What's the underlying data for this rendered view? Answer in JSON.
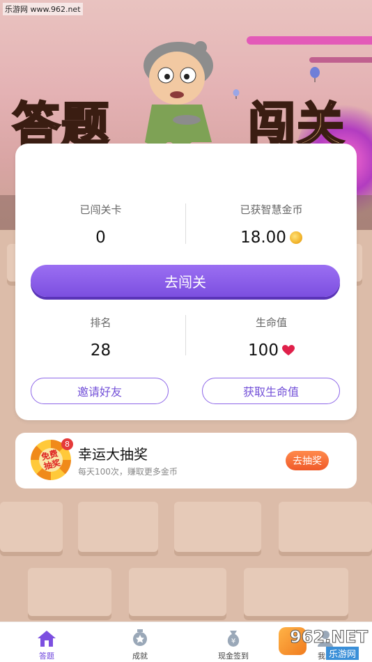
{
  "watermark": "乐游网 www.962.net",
  "title": {
    "left": "答题",
    "right": "闯关"
  },
  "stats": {
    "levels_label": "已闯关卡",
    "levels_value": "0",
    "coins_label": "已获智慧金币",
    "coins_value": "18.00",
    "rank_label": "排名",
    "rank_value": "28",
    "life_label": "生命值",
    "life_value": "100"
  },
  "buttons": {
    "go": "去闯关",
    "invite": "邀请好友",
    "get_life": "获取生命值"
  },
  "lottery": {
    "title": "幸运大抽奖",
    "subtitle": "每天100次，赚取更多金币",
    "button": "去抽奖",
    "badge": "8",
    "wheel_text": "免费抽奖"
  },
  "tabs": [
    {
      "label": "答题",
      "icon": "home-icon",
      "active": true
    },
    {
      "label": "成就",
      "icon": "medal-icon",
      "active": false
    },
    {
      "label": "现金签到",
      "icon": "money-bag-icon",
      "active": false
    },
    {
      "label": "我的",
      "icon": "user-icon",
      "active": false
    }
  ],
  "bottom_watermark": {
    "brand": "962.NET",
    "sub": "乐游网"
  },
  "colors": {
    "accent": "#7c4fe0",
    "lottery_button": "#f05a2a",
    "heart": "#e0204a"
  }
}
